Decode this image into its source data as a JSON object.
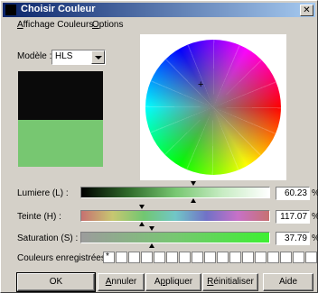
{
  "window": {
    "title": "Choisir Couleur",
    "close_glyph": "✕"
  },
  "menu": {
    "items": [
      {
        "first": "A",
        "rest": "ffichage Couleurs"
      },
      {
        "first": "O",
        "rest": "ptions"
      }
    ]
  },
  "model": {
    "label": "Modèle :",
    "value": "HLS"
  },
  "swatches": {
    "previous": "#0a0a0a",
    "current": "#77c771"
  },
  "wheel": {
    "cross": "+"
  },
  "sliders": {
    "lumiere": {
      "label": "Lumiere (L) :",
      "value": "60.23",
      "unit": "%"
    },
    "teinte": {
      "label": "Teinte (H) :",
      "value": "117.07",
      "unit": "%"
    },
    "saturation": {
      "label": "Saturation (S) :",
      "value": "37.79",
      "unit": "%"
    }
  },
  "saved_colors": {
    "label": "Couleurs enregistrées:",
    "first_marker": "*"
  },
  "buttons": {
    "ok": "OK",
    "annuler": {
      "first": "A",
      "rest": "nnuler"
    },
    "appliquer": {
      "pre": "A",
      "u": "p",
      "rest": "pliquer"
    },
    "reinit": {
      "first": "R",
      "rest": "éinitialiser"
    },
    "aide": "Aide"
  }
}
